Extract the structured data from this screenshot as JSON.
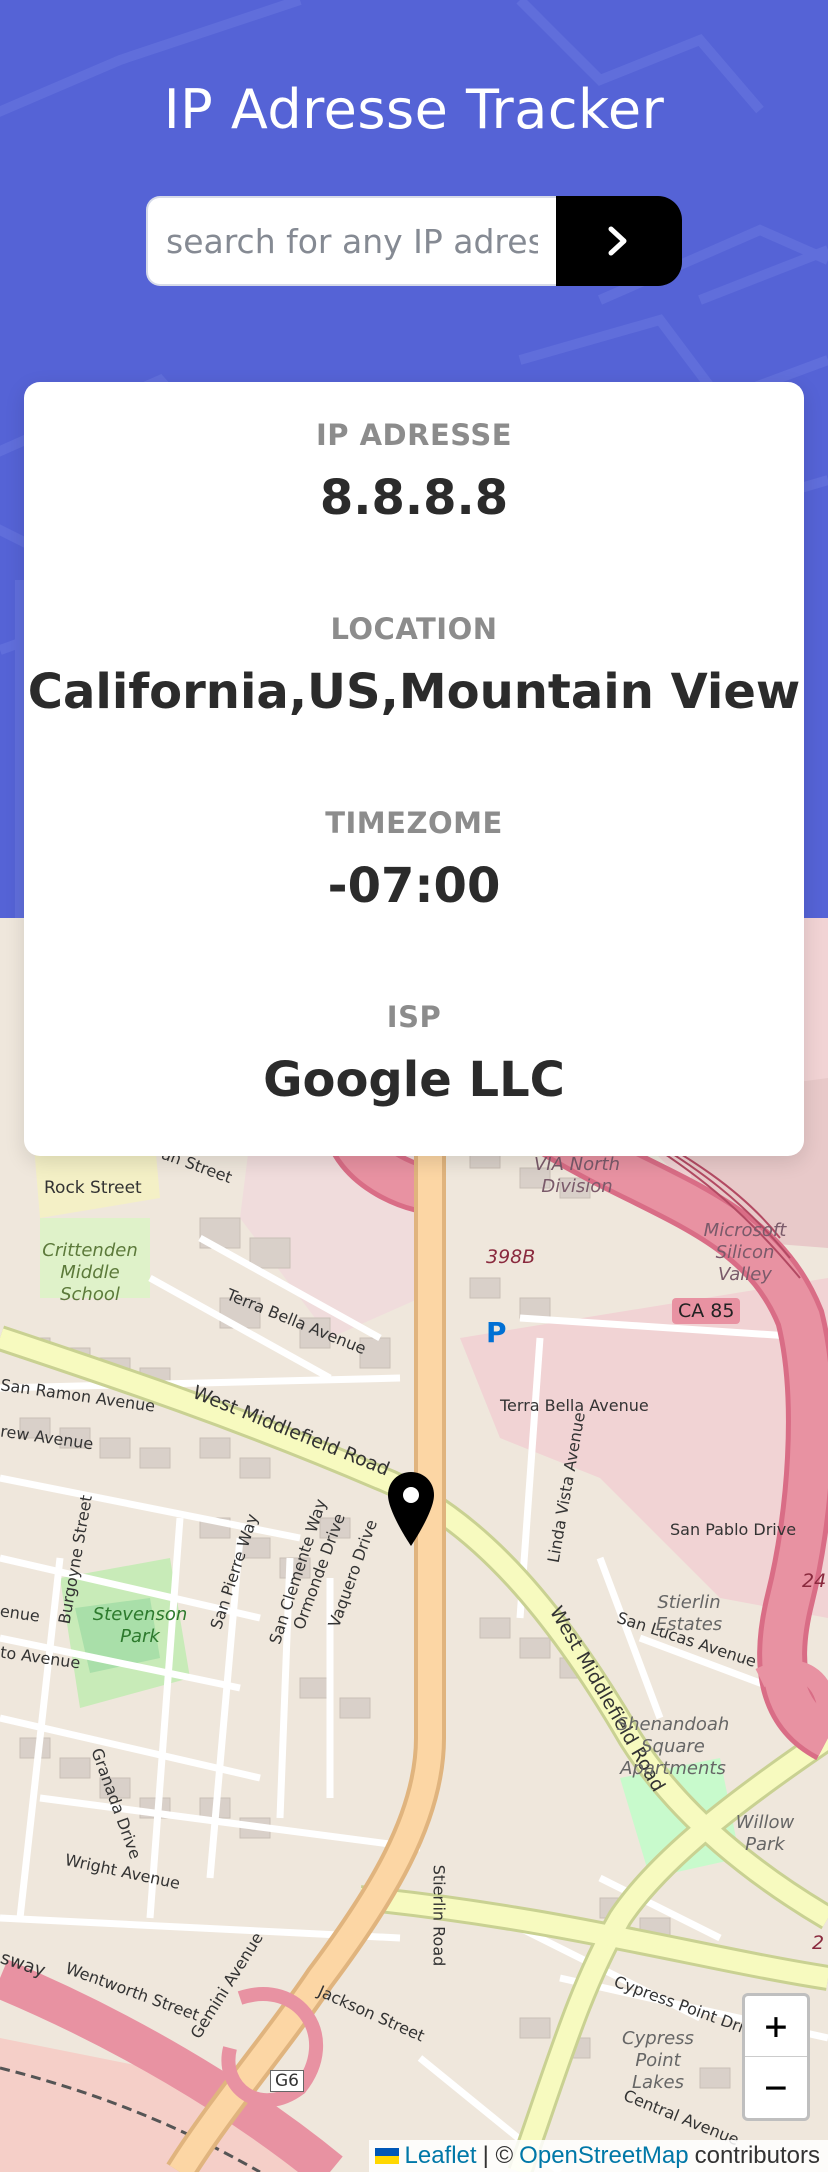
{
  "header": {
    "title": "IP Adresse Tracker",
    "search_placeholder": "search for any IP adress"
  },
  "info": {
    "ip": {
      "label": "IP ADRESSE",
      "value": "8.8.8.8"
    },
    "location": {
      "label": "LOCATION",
      "value": "California,US,Mountain View"
    },
    "timezone": {
      "label": "TIMEZOME",
      "value": "-07:00"
    },
    "isp": {
      "label": "ISP",
      "value": "Google LLC"
    }
  },
  "map": {
    "labels": {
      "rock_street": "Rock Street",
      "crittenden": "Crittenden Middle School",
      "via_north": "VIA North Division",
      "microsoft": "Microsoft Silicon Valley",
      "route_398b": "398B",
      "ca85": "CA 85",
      "terra_bella": "Terra Bella Avenue",
      "terra_bella_2": "Terra Bella Avenue",
      "west_middlefield": "West Middlefield Road",
      "west_middlefield_2": "West Middlefield Road",
      "san_ramon": "San Ramon Avenue",
      "san_pablo": "San Pablo Drive",
      "stevenson": "Stevenson Park",
      "stierlin_estates": "Stierlin Estates",
      "san_lucas": "San Lucas Avenue",
      "shenandoah": "Shenandoah Square Apartments",
      "willow_park": "Willow Park",
      "linda_vista": "Linda Vista Avenue",
      "wright": "Wright Avenue",
      "wentworth": "Wentworth Street",
      "jackson": "Jackson Street",
      "stierlin_road": "Stierlin Road",
      "cypress_point": "Cypress Point Drive",
      "cypress_lakes": "Cypress Point Lakes",
      "g6": "G6",
      "central": "Central Avenue",
      "granada": "Granada Drive",
      "burgoyne": "Burgoyne Street",
      "ormonde": "Ormonde Drive",
      "vaquero": "Vaquero Drive",
      "san_clemente": "San Clemente Way",
      "san_pierre": "San Pierre Way",
      "gemini": "Gemini Avenue",
      "parking": "P",
      "highway_24": "24",
      "highway_2": "2",
      "freeway": "sway",
      "rew_avenue": "rew Avenue",
      "enue": "enue",
      "to_avenue": "to Avenue",
      "an_street": "an Street"
    },
    "zoom_in": "+",
    "zoom_out": "−",
    "attribution": {
      "leaflet": "Leaflet",
      "separator": "| ©",
      "osm": "OpenStreetMap",
      "suffix": "contributors"
    }
  },
  "colors": {
    "header_bg": "#5563d6",
    "accent_dark": "#000000",
    "label_gray": "#8c8c8c",
    "value_dark": "#2b2b2b",
    "map_land": "#f0e9df",
    "map_commercial": "#f1d5d5",
    "map_motorway": "#e892a2",
    "map_primary": "#fcd6a4",
    "map_secondary": "#f7fabf",
    "map_park": "#c8facc"
  }
}
